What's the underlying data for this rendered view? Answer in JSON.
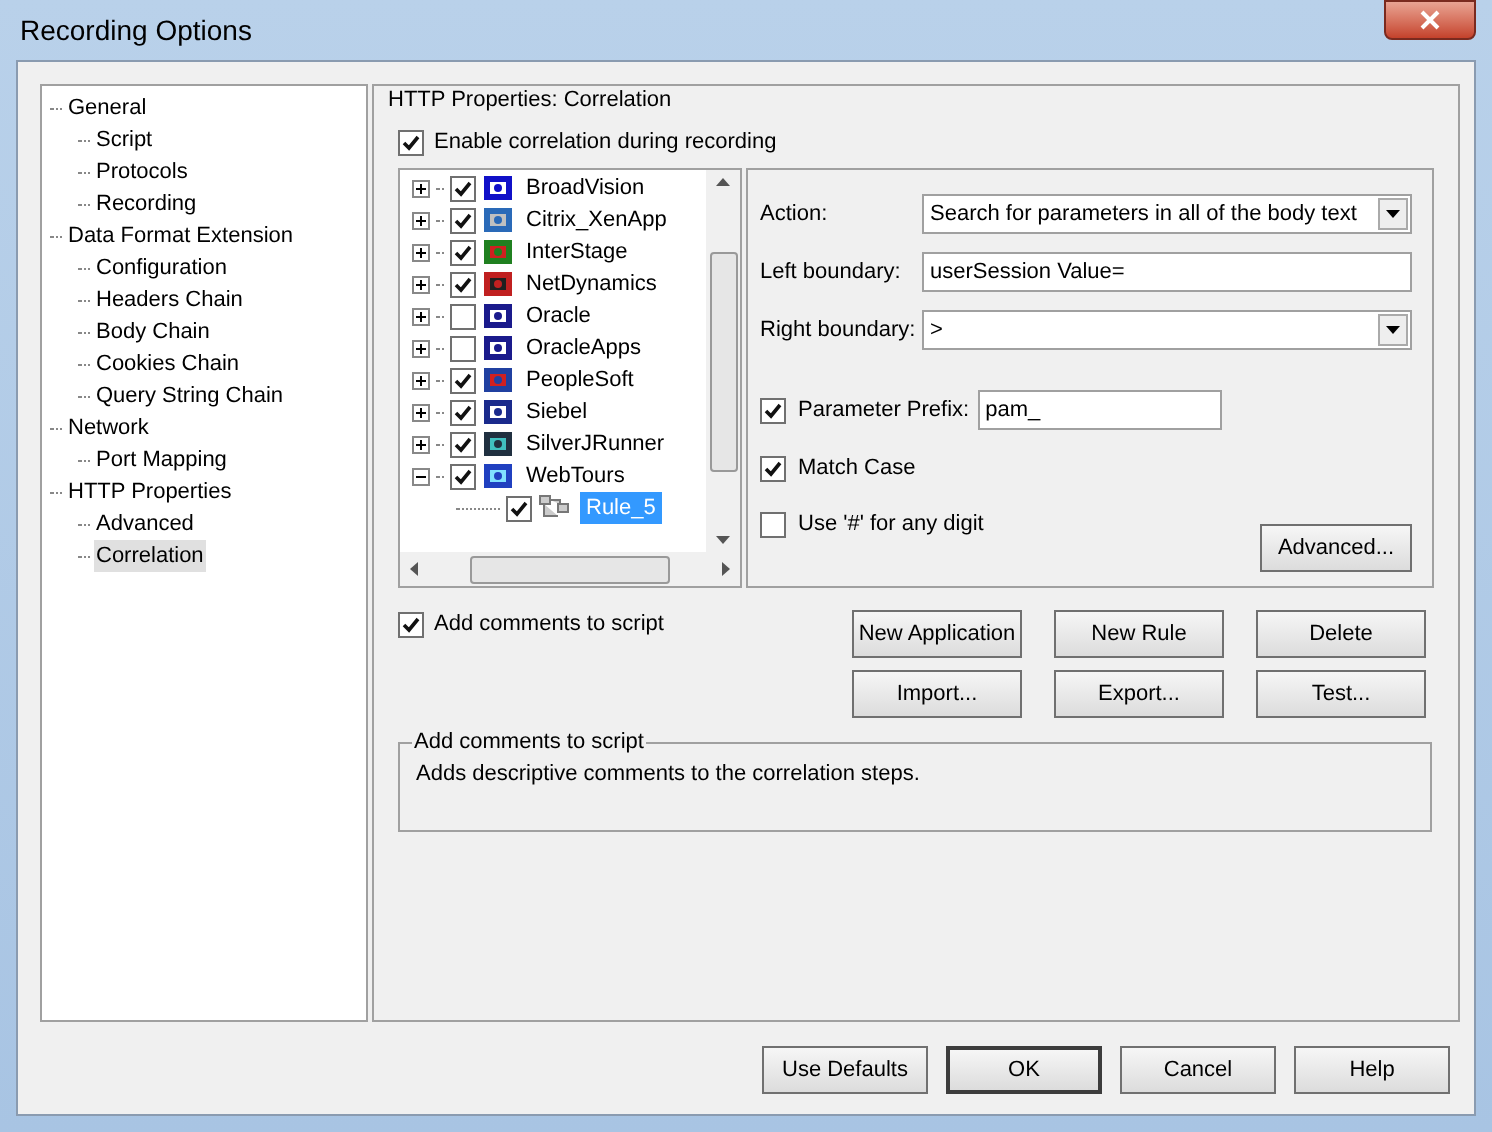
{
  "window": {
    "title": "Recording Options"
  },
  "nav": [
    {
      "label": "General",
      "selected": false,
      "children": [
        {
          "label": "Script",
          "selected": false
        },
        {
          "label": "Protocols",
          "selected": false
        },
        {
          "label": "Recording",
          "selected": false
        }
      ]
    },
    {
      "label": "Data Format Extension",
      "selected": false,
      "children": [
        {
          "label": "Configuration",
          "selected": false
        },
        {
          "label": "Headers Chain",
          "selected": false
        },
        {
          "label": "Body Chain",
          "selected": false
        },
        {
          "label": "Cookies Chain",
          "selected": false
        },
        {
          "label": "Query String Chain",
          "selected": false
        }
      ]
    },
    {
      "label": "Network",
      "selected": false,
      "children": [
        {
          "label": "Port Mapping",
          "selected": false
        }
      ]
    },
    {
      "label": "HTTP Properties",
      "selected": false,
      "children": [
        {
          "label": "Advanced",
          "selected": false
        },
        {
          "label": "Correlation",
          "selected": true
        }
      ]
    }
  ],
  "section_title": "HTTP Properties: Correlation",
  "enable_correlation": {
    "label": "Enable correlation during recording",
    "checked": true
  },
  "applications": [
    {
      "label": "BroadVision",
      "checked": true,
      "expanded": false
    },
    {
      "label": "Citrix_XenApp",
      "checked": true,
      "expanded": false
    },
    {
      "label": "InterStage",
      "checked": true,
      "expanded": false
    },
    {
      "label": "NetDynamics",
      "checked": true,
      "expanded": false
    },
    {
      "label": "Oracle",
      "checked": false,
      "expanded": false
    },
    {
      "label": "OracleApps",
      "checked": false,
      "expanded": false
    },
    {
      "label": "PeopleSoft",
      "checked": true,
      "expanded": false
    },
    {
      "label": "Siebel",
      "checked": true,
      "expanded": false
    },
    {
      "label": "SilverJRunner",
      "checked": true,
      "expanded": false
    },
    {
      "label": "WebTours",
      "checked": true,
      "expanded": true,
      "children": [
        {
          "label": "Rule_5",
          "checked": true,
          "selected": true
        }
      ]
    }
  ],
  "rule": {
    "action": {
      "label": "Action:",
      "value": "Search for parameters in all of the body text"
    },
    "left_boundary": {
      "label": "Left boundary:",
      "value": "userSession Value="
    },
    "right_boundary": {
      "label": "Right boundary:",
      "value": ">"
    },
    "parameter_prefix": {
      "label": "Parameter Prefix:",
      "checked": true,
      "value": "pam_"
    },
    "match_case": {
      "label": "Match Case",
      "checked": true
    },
    "use_hash": {
      "label": "Use '#' for any digit",
      "checked": false
    },
    "advanced_button": "Advanced..."
  },
  "add_comments": {
    "label": "Add comments to script",
    "checked": true
  },
  "buttons": [
    "New Application",
    "New Rule",
    "Delete",
    "Import...",
    "Export...",
    "Test..."
  ],
  "description": {
    "title": "Add comments to script",
    "text": "Adds descriptive comments to the correlation steps."
  },
  "footer_buttons": [
    {
      "label": "Use Defaults",
      "default": false
    },
    {
      "label": "OK",
      "default": true
    },
    {
      "label": "Cancel",
      "default": false
    },
    {
      "label": "Help",
      "default": false
    }
  ]
}
